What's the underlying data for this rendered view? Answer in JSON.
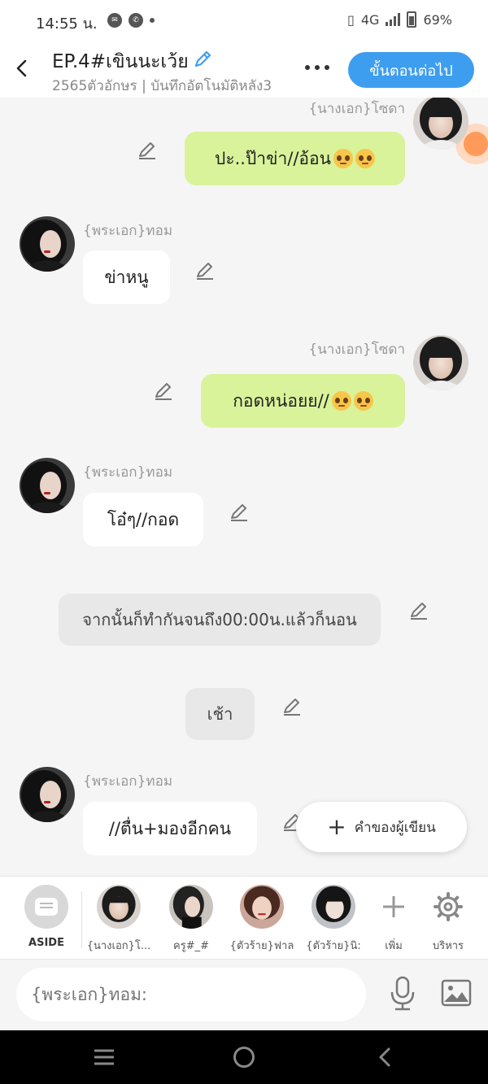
{
  "status_bar": {
    "time": "14:55 น.",
    "network": "4G",
    "battery": "69%"
  },
  "header": {
    "title": "EP.4#เขินนะเว้ย",
    "subtitle": "2565ตัวอักษร | บันทึกอัตโนมัติหลัง3",
    "next_button": "ขั้นตอนต่อไป"
  },
  "messages": [
    {
      "speaker": "{นางเอก}โซดา",
      "text": "ปะ..ป๊าข่า//อ้อน",
      "emoji_count": 2
    },
    {
      "speaker": "{พระเอก}ทอม",
      "text": "ข่าหนู"
    },
    {
      "speaker": "{นางเอก}โซดา",
      "text": "กอดหน่อยย//",
      "emoji_count": 2
    },
    {
      "speaker": "{พระเอก}ทอม",
      "text": "โอ๋ๆ//กอด"
    },
    {
      "type": "narration",
      "text": "จากนั้นก็ทำกันจนถึง00:00น.แล้วก็นอน"
    },
    {
      "type": "narration",
      "text": "เช้า"
    },
    {
      "speaker": "{พระเอก}ทอม",
      "text": "//ตื่น+มองอีกคน"
    }
  ],
  "writer_button": "คำของผู้เขียน",
  "characters": {
    "aside": "ASIDE",
    "items": [
      "{นางเอก}โ...",
      "ครู#_#",
      "{ตัวร้าย}ฟาล",
      "{ตัวร้าย}นิ:"
    ],
    "add": "เพิ่ม",
    "manage": "บริหาร"
  },
  "input": {
    "placeholder": "{พระเอก}ทอม:"
  },
  "colors": {
    "accent": "#3d9ef0",
    "bubble_green": "#d9f39a",
    "background": "#f5f5f5"
  }
}
